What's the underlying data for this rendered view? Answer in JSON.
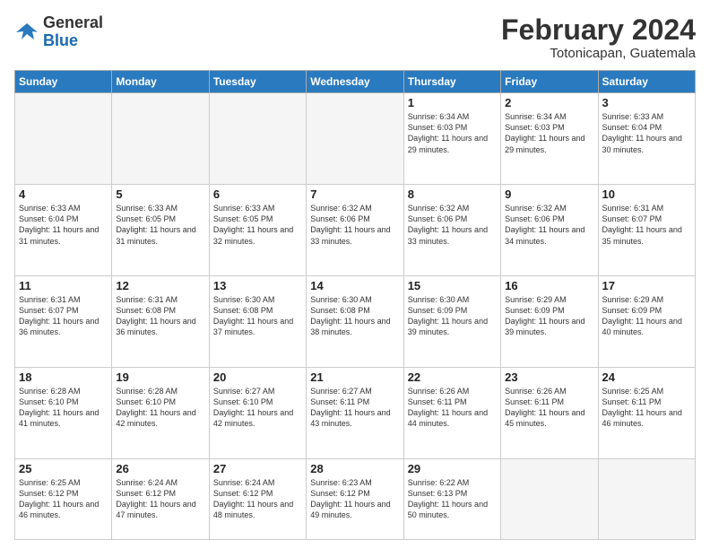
{
  "logo": {
    "general": "General",
    "blue": "Blue"
  },
  "header": {
    "title": "February 2024",
    "subtitle": "Totonicapan, Guatemala"
  },
  "weekdays": [
    "Sunday",
    "Monday",
    "Tuesday",
    "Wednesday",
    "Thursday",
    "Friday",
    "Saturday"
  ],
  "weeks": [
    [
      {
        "day": "",
        "info": ""
      },
      {
        "day": "",
        "info": ""
      },
      {
        "day": "",
        "info": ""
      },
      {
        "day": "",
        "info": ""
      },
      {
        "day": "1",
        "info": "Sunrise: 6:34 AM\nSunset: 6:03 PM\nDaylight: 11 hours and 29 minutes."
      },
      {
        "day": "2",
        "info": "Sunrise: 6:34 AM\nSunset: 6:03 PM\nDaylight: 11 hours and 29 minutes."
      },
      {
        "day": "3",
        "info": "Sunrise: 6:33 AM\nSunset: 6:04 PM\nDaylight: 11 hours and 30 minutes."
      }
    ],
    [
      {
        "day": "4",
        "info": "Sunrise: 6:33 AM\nSunset: 6:04 PM\nDaylight: 11 hours and 31 minutes."
      },
      {
        "day": "5",
        "info": "Sunrise: 6:33 AM\nSunset: 6:05 PM\nDaylight: 11 hours and 31 minutes."
      },
      {
        "day": "6",
        "info": "Sunrise: 6:33 AM\nSunset: 6:05 PM\nDaylight: 11 hours and 32 minutes."
      },
      {
        "day": "7",
        "info": "Sunrise: 6:32 AM\nSunset: 6:06 PM\nDaylight: 11 hours and 33 minutes."
      },
      {
        "day": "8",
        "info": "Sunrise: 6:32 AM\nSunset: 6:06 PM\nDaylight: 11 hours and 33 minutes."
      },
      {
        "day": "9",
        "info": "Sunrise: 6:32 AM\nSunset: 6:06 PM\nDaylight: 11 hours and 34 minutes."
      },
      {
        "day": "10",
        "info": "Sunrise: 6:31 AM\nSunset: 6:07 PM\nDaylight: 11 hours and 35 minutes."
      }
    ],
    [
      {
        "day": "11",
        "info": "Sunrise: 6:31 AM\nSunset: 6:07 PM\nDaylight: 11 hours and 36 minutes."
      },
      {
        "day": "12",
        "info": "Sunrise: 6:31 AM\nSunset: 6:08 PM\nDaylight: 11 hours and 36 minutes."
      },
      {
        "day": "13",
        "info": "Sunrise: 6:30 AM\nSunset: 6:08 PM\nDaylight: 11 hours and 37 minutes."
      },
      {
        "day": "14",
        "info": "Sunrise: 6:30 AM\nSunset: 6:08 PM\nDaylight: 11 hours and 38 minutes."
      },
      {
        "day": "15",
        "info": "Sunrise: 6:30 AM\nSunset: 6:09 PM\nDaylight: 11 hours and 39 minutes."
      },
      {
        "day": "16",
        "info": "Sunrise: 6:29 AM\nSunset: 6:09 PM\nDaylight: 11 hours and 39 minutes."
      },
      {
        "day": "17",
        "info": "Sunrise: 6:29 AM\nSunset: 6:09 PM\nDaylight: 11 hours and 40 minutes."
      }
    ],
    [
      {
        "day": "18",
        "info": "Sunrise: 6:28 AM\nSunset: 6:10 PM\nDaylight: 11 hours and 41 minutes."
      },
      {
        "day": "19",
        "info": "Sunrise: 6:28 AM\nSunset: 6:10 PM\nDaylight: 11 hours and 42 minutes."
      },
      {
        "day": "20",
        "info": "Sunrise: 6:27 AM\nSunset: 6:10 PM\nDaylight: 11 hours and 42 minutes."
      },
      {
        "day": "21",
        "info": "Sunrise: 6:27 AM\nSunset: 6:11 PM\nDaylight: 11 hours and 43 minutes."
      },
      {
        "day": "22",
        "info": "Sunrise: 6:26 AM\nSunset: 6:11 PM\nDaylight: 11 hours and 44 minutes."
      },
      {
        "day": "23",
        "info": "Sunrise: 6:26 AM\nSunset: 6:11 PM\nDaylight: 11 hours and 45 minutes."
      },
      {
        "day": "24",
        "info": "Sunrise: 6:25 AM\nSunset: 6:11 PM\nDaylight: 11 hours and 46 minutes."
      }
    ],
    [
      {
        "day": "25",
        "info": "Sunrise: 6:25 AM\nSunset: 6:12 PM\nDaylight: 11 hours and 46 minutes."
      },
      {
        "day": "26",
        "info": "Sunrise: 6:24 AM\nSunset: 6:12 PM\nDaylight: 11 hours and 47 minutes."
      },
      {
        "day": "27",
        "info": "Sunrise: 6:24 AM\nSunset: 6:12 PM\nDaylight: 11 hours and 48 minutes."
      },
      {
        "day": "28",
        "info": "Sunrise: 6:23 AM\nSunset: 6:12 PM\nDaylight: 11 hours and 49 minutes."
      },
      {
        "day": "29",
        "info": "Sunrise: 6:22 AM\nSunset: 6:13 PM\nDaylight: 11 hours and 50 minutes."
      },
      {
        "day": "",
        "info": ""
      },
      {
        "day": "",
        "info": ""
      }
    ]
  ]
}
